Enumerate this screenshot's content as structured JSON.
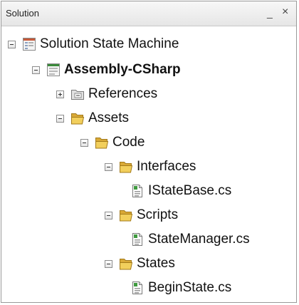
{
  "panel": {
    "title": "Solution",
    "pin_glyph": "_",
    "close_glyph": "×"
  },
  "tree": {
    "solution": "Solution State Machine",
    "project": "Assembly-CSharp",
    "references": "References",
    "assets": "Assets",
    "code": "Code",
    "interfaces": "Interfaces",
    "istatebase": "IStateBase.cs",
    "scripts": "Scripts",
    "statemanager": "StateManager.cs",
    "states": "States",
    "beginstate": "BeginState.cs"
  }
}
